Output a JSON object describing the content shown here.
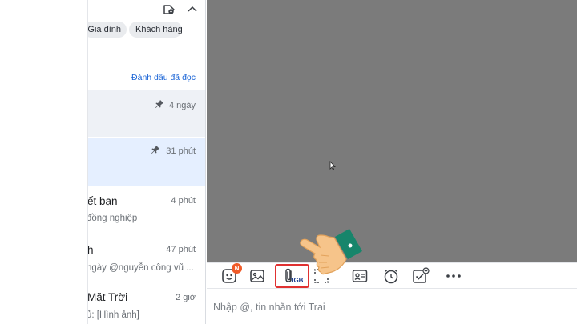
{
  "filters": {
    "chips": [
      "Gia đình",
      "Khách hàng"
    ]
  },
  "list_header": {
    "mark_all_read": "Đánh dấu đã đọc"
  },
  "conversations": [
    {
      "name": "",
      "preview": "",
      "time": "4 ngày",
      "pinned": true
    },
    {
      "name": "",
      "preview": "",
      "time": "31 phút",
      "pinned": true
    },
    {
      "name": "ết bạn",
      "preview": "đồng nghiệp",
      "time": "4 phút",
      "pinned": false
    },
    {
      "name": "h",
      "preview": "ngày @nguyễn công vũ ...",
      "time": "47 phút",
      "pinned": false
    },
    {
      "name": "Mặt Trời",
      "preview": "ủ: [Hình ảnh]",
      "time": "2 giờ",
      "pinned": false
    }
  ],
  "toolbar": {
    "sticker_badge": "N",
    "attach_size": "1GB",
    "icons": [
      "sticker-icon",
      "image-icon",
      "attach-file-icon",
      "screenshot-icon",
      "contact-card-icon",
      "reminder-icon",
      "task-icon",
      "more-icon"
    ]
  },
  "composer": {
    "placeholder": "Nhập @, tin nhắn tới Trai"
  },
  "colors": {
    "chat_background": "#7b7b7b",
    "link_blue": "#1a64d6",
    "selected_row": "#e5efff",
    "highlight_red": "#e03131",
    "badge_orange": "#f05a28",
    "cuff_green": "#17856b"
  }
}
